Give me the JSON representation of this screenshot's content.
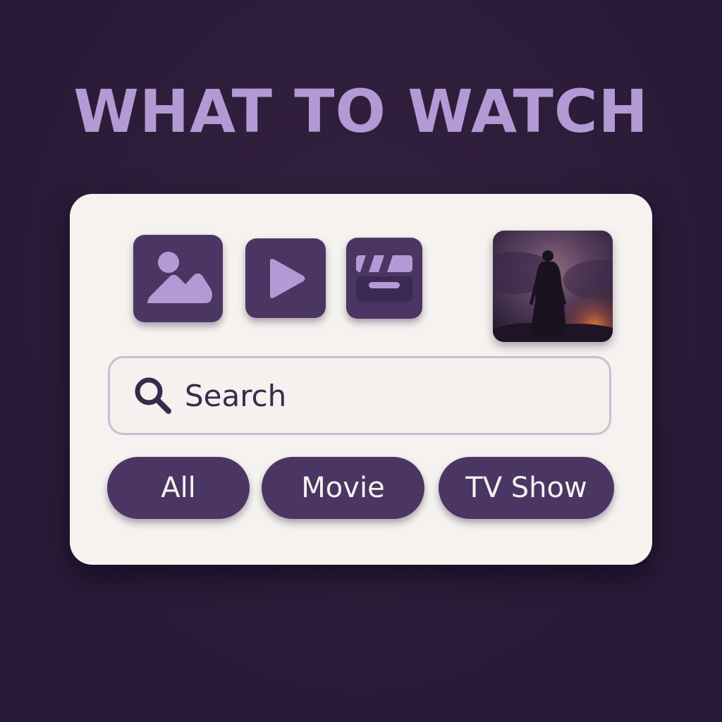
{
  "title": "WHAT TO WATCH",
  "media_tiles": [
    {
      "name": "image",
      "icon": "image-icon"
    },
    {
      "name": "play",
      "icon": "play-icon"
    },
    {
      "name": "clapperboard",
      "icon": "clapperboard-icon"
    }
  ],
  "thumbnail": {
    "icon": "silhouette-figure-image"
  },
  "search": {
    "placeholder": "Search",
    "icon": "search-icon"
  },
  "filters": [
    "All",
    "Movie",
    "TV Show"
  ],
  "colors": {
    "background": "#2c1c3b",
    "title": "#b39ad4",
    "card": "#f5f2ef",
    "accent": "#4b3563",
    "icon_light": "#b39ad4",
    "button_text": "#f5f2ef"
  }
}
